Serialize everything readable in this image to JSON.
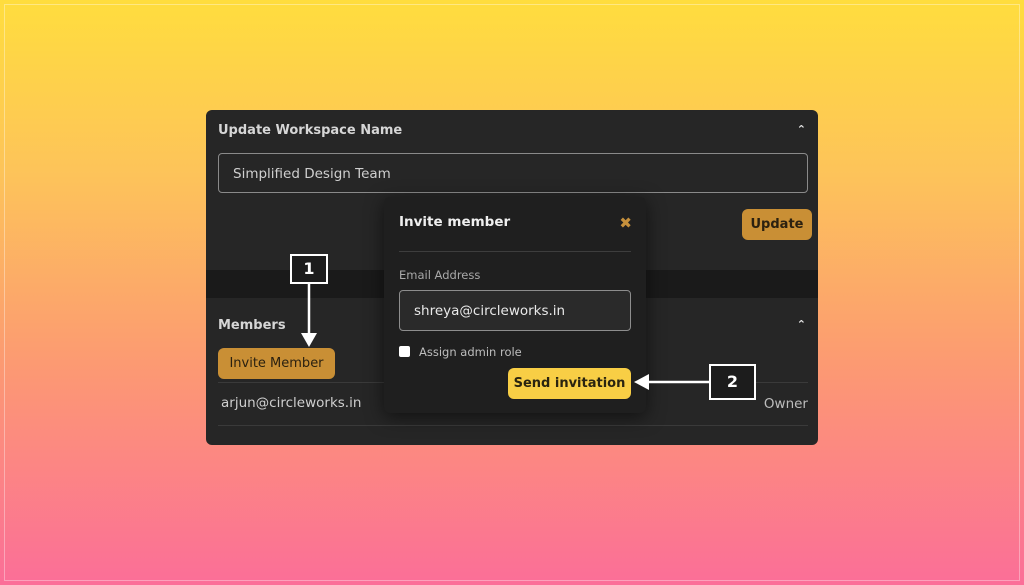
{
  "workspace": {
    "section_title": "Update Workspace Name",
    "name_value": "Simplified Design Team",
    "update_label": "Update",
    "collapse_icon": "chevron-up-icon"
  },
  "members": {
    "section_title": "Members",
    "invite_label": "Invite Member",
    "collapse_icon": "chevron-up-icon",
    "list": [
      {
        "email": "arjun@circleworks.in",
        "role": "Owner"
      }
    ]
  },
  "modal": {
    "title": "Invite member",
    "close_icon": "close-icon",
    "email_label": "Email Address",
    "email_value": "shreya@circleworks.in",
    "admin_checkbox_label": "Assign admin role",
    "admin_checked": false,
    "send_label": "Send invitation"
  },
  "annotations": [
    {
      "number": "1",
      "target": "Invite Member"
    },
    {
      "number": "2",
      "target": "Send invitation"
    }
  ],
  "colors": {
    "accent_gold": "#c98f35",
    "send_yellow": "#f8ce45",
    "panel_bg": "#262626"
  }
}
